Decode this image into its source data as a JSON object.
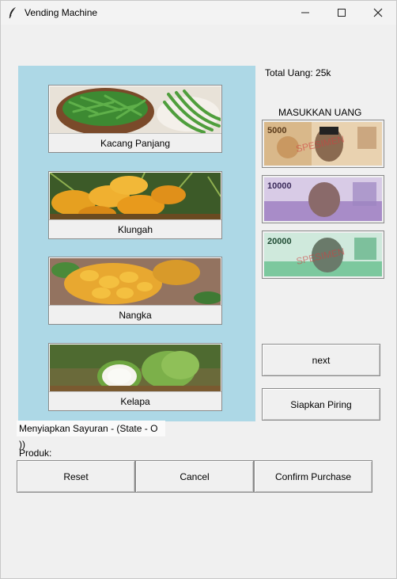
{
  "window": {
    "title": "Vending Machine"
  },
  "products": [
    {
      "label": "Kacang Panjang",
      "image": "long-beans-photo"
    },
    {
      "label": "Klungah",
      "image": "young-coconut-photo"
    },
    {
      "label": "Nangka",
      "image": "jackfruit-photo"
    },
    {
      "label": "Kelapa",
      "image": "coconut-photo"
    }
  ],
  "total_money": "Total Uang: 25k",
  "insert_money_label": "MASUKKAN UANG",
  "banknotes": [
    {
      "denomination": "5000",
      "watermark": "SPESIMEN",
      "color": "#c8a26a"
    },
    {
      "denomination": "10000",
      "watermark": "",
      "color": "#9c7cc0"
    },
    {
      "denomination": "20000",
      "watermark": "SPESIMEN",
      "color": "#6cc49a"
    }
  ],
  "buttons": {
    "next": "next",
    "prepare_plate": "Siapkan Piring",
    "reset": "Reset",
    "cancel": "Cancel",
    "confirm": "Confirm Purchase"
  },
  "state_text": "Menyiapkan Sayuran - (State - O ))",
  "product_label": "Produk:",
  "colors": {
    "panel": "#add8e6",
    "window": "#f0f0f0"
  }
}
